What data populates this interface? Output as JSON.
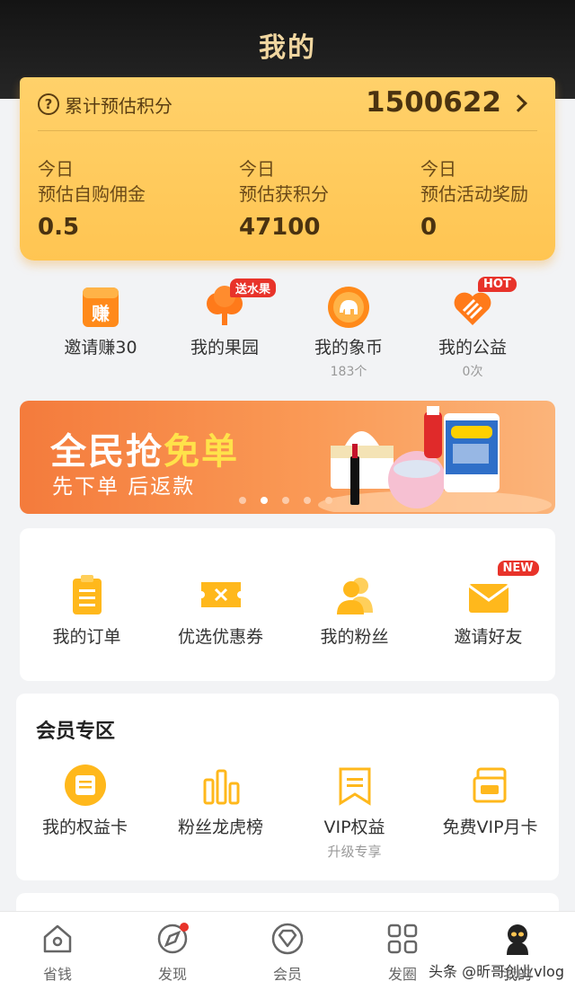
{
  "header": {
    "title": "我的"
  },
  "points": {
    "help_icon": "question-circle-icon",
    "label": "累计预估积分",
    "total": "1500622",
    "columns": [
      {
        "line1": "今日",
        "line2": "预估自购佣金",
        "value": "0.5"
      },
      {
        "line1": "今日",
        "line2": "预估获积分",
        "value": "47100"
      },
      {
        "line1": "今日",
        "line2": "预估活动奖励",
        "value": "0"
      }
    ]
  },
  "quick": [
    {
      "label": "邀请赚30",
      "icon": "earn-icon",
      "icon_text": "赚"
    },
    {
      "label": "我的果园",
      "icon": "tree-icon",
      "tag": "送水果"
    },
    {
      "label": "我的象币",
      "icon": "elephant-coin-icon",
      "sub": "183个"
    },
    {
      "label": "我的公益",
      "icon": "heart-icon",
      "tag": "HOT",
      "sub": "0次"
    }
  ],
  "banner": {
    "title_main": "全民抢",
    "title_highlight": "免单",
    "subtitle": "先下单 后返款",
    "active_dot": 1
  },
  "orders": [
    {
      "label": "我的订单",
      "icon": "clipboard-icon"
    },
    {
      "label": "优选优惠券",
      "icon": "coupon-icon"
    },
    {
      "label": "我的粉丝",
      "icon": "fans-icon"
    },
    {
      "label": "邀请好友",
      "icon": "envelope-icon",
      "tag": "NEW"
    }
  ],
  "member": {
    "title": "会员专区",
    "items": [
      {
        "label": "我的权益卡",
        "icon": "benefit-card-icon"
      },
      {
        "label": "粉丝龙虎榜",
        "icon": "bar-ranking-icon"
      },
      {
        "label": "VIP权益",
        "icon": "vip-ribbon-icon",
        "sub": "升级专享"
      },
      {
        "label": "免费VIP月卡",
        "icon": "vip-card-icon"
      }
    ]
  },
  "tabs": [
    {
      "label": "省钱",
      "icon": "home-icon"
    },
    {
      "label": "发现",
      "icon": "compass-icon"
    },
    {
      "label": "会员",
      "icon": "member-diamond-icon"
    },
    {
      "label": "发圈",
      "icon": "grid-icon"
    },
    {
      "label": "我的",
      "icon": "profile-icon",
      "active": true
    }
  ],
  "watermark": "头条 @昕哥创业vlog",
  "colors": {
    "accent": "#ffc552",
    "icon": "#ffb81c",
    "tag": "#e8332a",
    "banner": "#f47b3c"
  }
}
